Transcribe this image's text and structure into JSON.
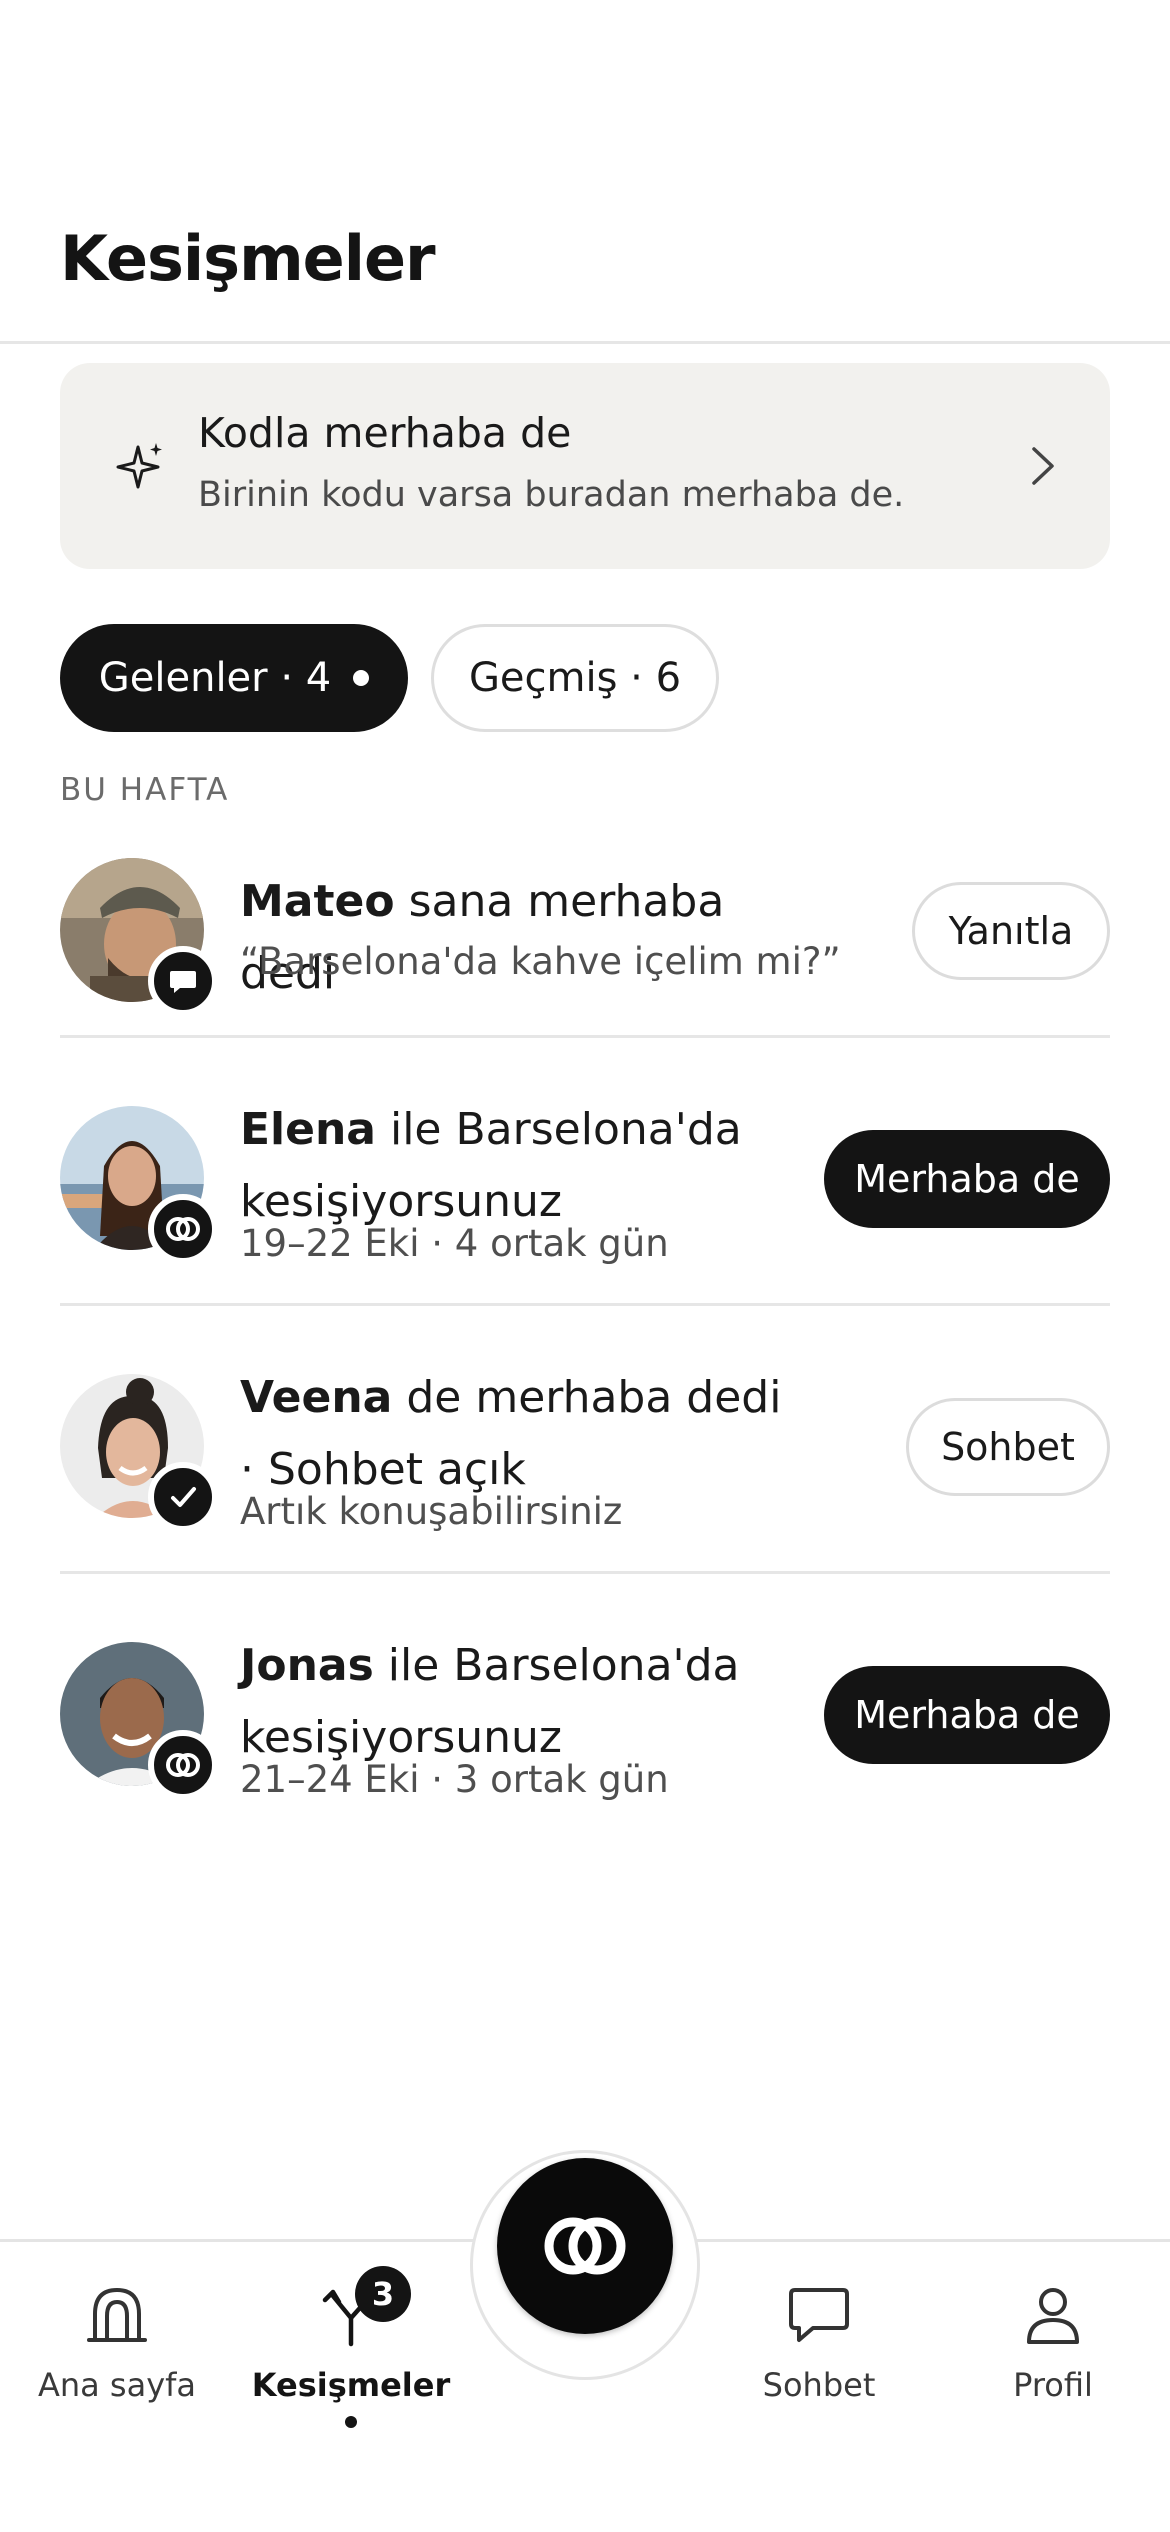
{
  "header": {
    "title": "Kesişmeler"
  },
  "code_card": {
    "title": "Kodla merhaba de",
    "subtitle": "Birinin kodu varsa buradan merhaba de."
  },
  "filters": {
    "incoming": "Gelenler · 4",
    "history": "Geçmiş · 6"
  },
  "section_label": "BU HAFTA",
  "rows": [
    {
      "name": "Mateo",
      "title_rest": " sana merhaba dedi",
      "subtitle": "“Barselona'da kahve içelim mi?”",
      "action": "Yanıtla",
      "badge_icon": "chat-bubble-icon"
    },
    {
      "name": "Elena",
      "title_rest": " ile Barselona'da kesişiyorsunuz",
      "subtitle": "19–22 Eki · 4 ortak gün",
      "action": "Merhaba de",
      "badge_icon": "crossing-icon"
    },
    {
      "name": "Veena",
      "title_rest": " de merhaba dedi · Sohbet açık",
      "subtitle": "Artık konuşabilirsiniz",
      "action": "Sohbet",
      "badge_icon": "check-icon"
    },
    {
      "name": "Jonas",
      "title_rest": " ile Barselona'da kesişiyorsunuz",
      "subtitle": "21–24 Eki · 3 ortak gün",
      "action": "Merhaba de",
      "badge_icon": "crossing-icon"
    }
  ],
  "tabbar": {
    "home": "Ana sayfa",
    "crossings": "Kesişmeler",
    "crossings_count": "3",
    "chat": "Sohbet",
    "profile": "Profil"
  },
  "colors": {
    "primary": "#141414",
    "card_bg": "#f2f1ee",
    "divider": "#e6e6e6"
  }
}
